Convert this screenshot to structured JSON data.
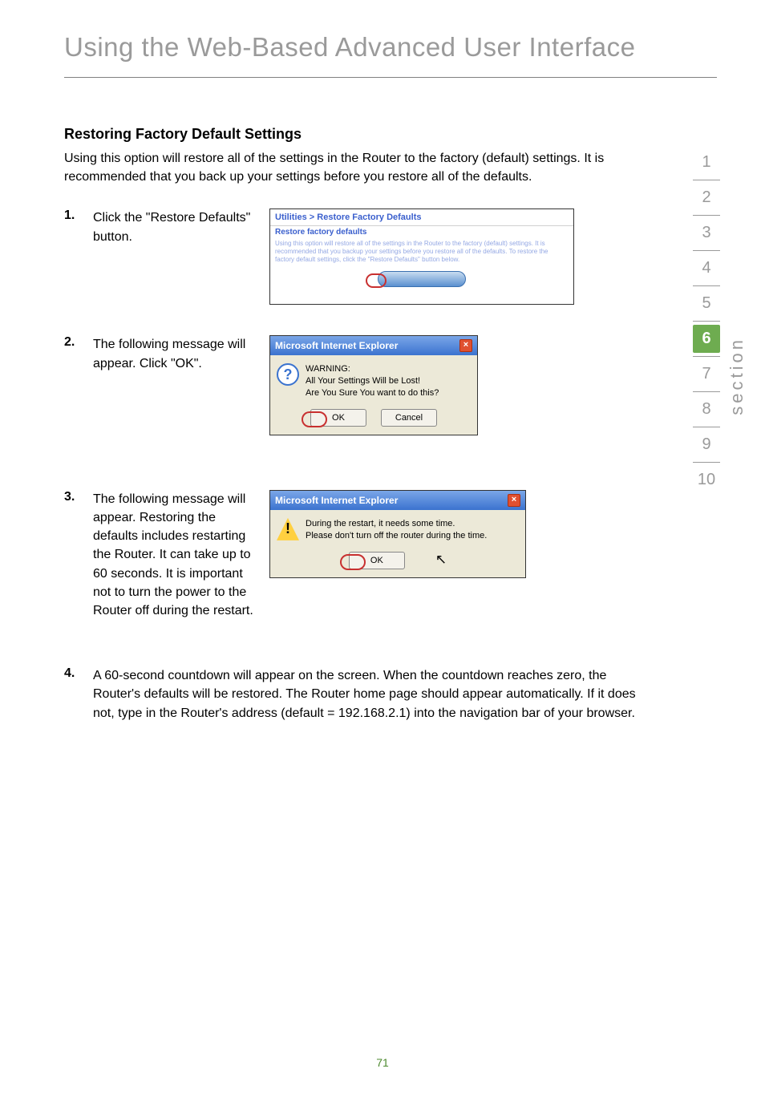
{
  "page": {
    "title": "Using the Web-Based Advanced User Interface",
    "subheading": "Restoring Factory Default Settings",
    "intro": "Using this option will restore all of the settings in the Router to the factory (default) settings. It is recommended that you back up your settings before you restore all of the defaults.",
    "page_number": "71"
  },
  "steps": [
    {
      "num": "1.",
      "text": "Click the \"Restore Defaults\" button."
    },
    {
      "num": "2.",
      "text": "The following message will appear. Click \"OK\"."
    },
    {
      "num": "3.",
      "text": "The following message will appear. Restoring the defaults includes restarting the Router. It can take up to 60 seconds. It is important not to turn the power to the Router off during the restart."
    },
    {
      "num": "4.",
      "text": "A 60-second countdown will appear on the screen. When the countdown reaches zero, the Router's defaults will be restored. The Router home page should appear automatically. If it does not, type in the Router's address (default = 192.168.2.1) into the navigation bar of your browser."
    }
  ],
  "shot1": {
    "header": "Utilities > Restore Factory Defaults",
    "subheader": "Restore factory defaults",
    "body": "Using this option will restore all of the settings in the Router to the factory (default) settings. It is recommended that you backup your settings before you restore all of the defaults. To restore the factory default settings, click the \"Restore Defaults\" button below."
  },
  "dialog2": {
    "title": "Microsoft Internet Explorer",
    "line1": "WARNING:",
    "line2": "All Your Settings Will be Lost!",
    "line3": "Are You Sure You want to do this?",
    "ok": "OK",
    "cancel": "Cancel"
  },
  "dialog3": {
    "title": "Microsoft Internet Explorer",
    "line1": "During the restart, it needs some time.",
    "line2": "Please don't turn off the router during the time.",
    "ok": "OK"
  },
  "sidenav": {
    "items": [
      "1",
      "2",
      "3",
      "4",
      "5",
      "6",
      "7",
      "8",
      "9",
      "10"
    ],
    "active_index": 5,
    "label": "section"
  }
}
